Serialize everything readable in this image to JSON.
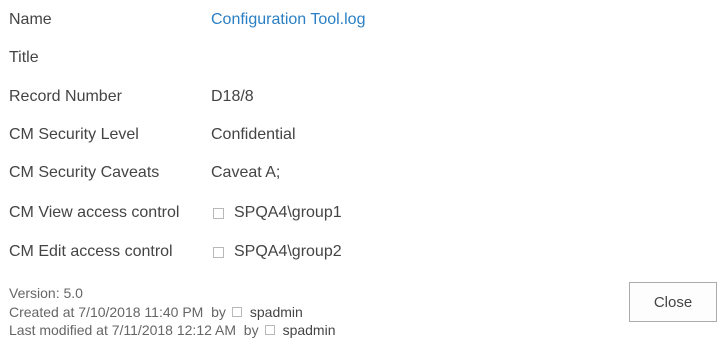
{
  "properties": {
    "name": {
      "label": "Name",
      "value": "Configuration Tool.log"
    },
    "title": {
      "label": "Title",
      "value": ""
    },
    "record_number": {
      "label": "Record Number",
      "value": "D18/8"
    },
    "security_level": {
      "label": "CM Security Level",
      "value": "Confidential"
    },
    "security_caveats": {
      "label": "CM Security Caveats",
      "value": "Caveat A;"
    },
    "view_access": {
      "label": "CM View access control",
      "value": "SPQA4\\group1"
    },
    "edit_access": {
      "label": "CM Edit access control",
      "value": "SPQA4\\group2"
    }
  },
  "footer": {
    "version": "Version: 5.0",
    "created_prefix": "Created at 7/10/2018 11:40 PM  by",
    "created_by": "spadmin",
    "modified_prefix": "Last modified at 7/11/2018 12:12 AM  by",
    "modified_by": "spadmin"
  },
  "actions": {
    "close_label": "Close"
  },
  "colors": {
    "link": "#2a7fc4",
    "text": "#444444",
    "muted": "#666666"
  },
  "icons": {
    "presence": "presence-indicator-icon"
  }
}
